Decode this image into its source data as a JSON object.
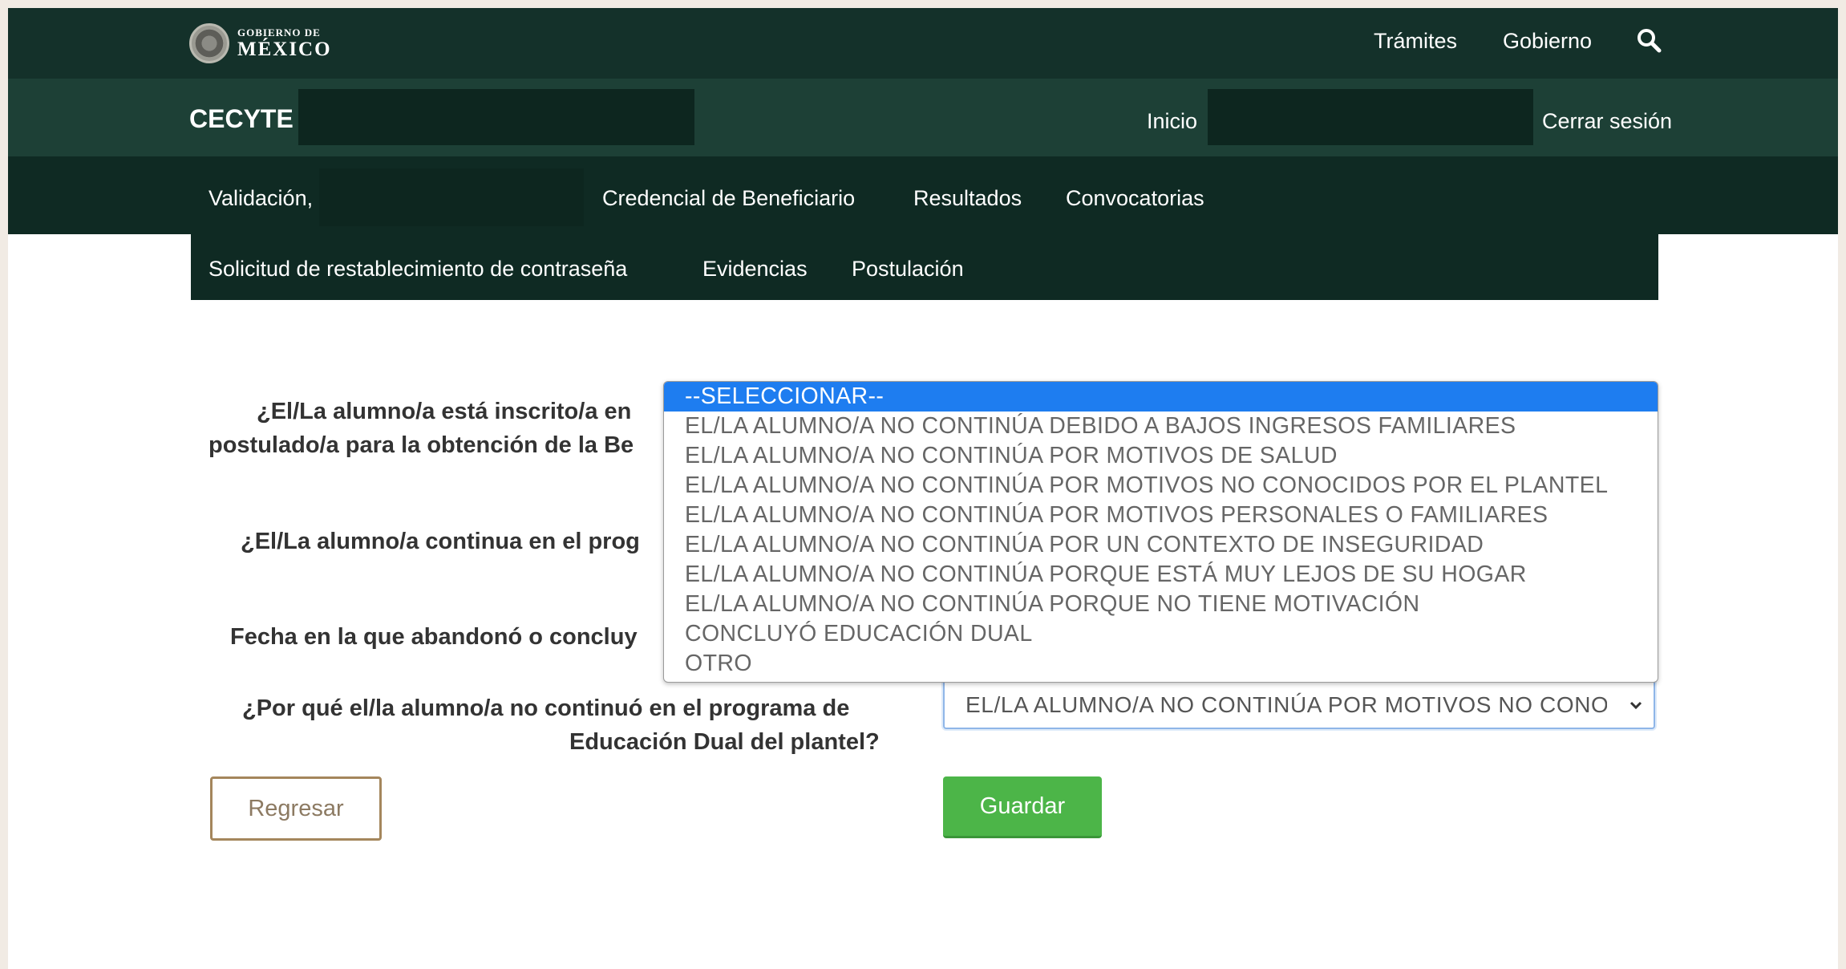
{
  "gov": {
    "logo_small": "GOBIERNO DE",
    "logo_big": "MÉXICO",
    "links": [
      "Trámites",
      "Gobierno"
    ],
    "search_icon": "search-icon"
  },
  "site": {
    "brand": "CECYTE",
    "home": "Inicio",
    "logout": "Cerrar sesión"
  },
  "nav": {
    "validacion": "Validación,",
    "credencial": "Credencial de Beneficiario",
    "resultados": "Resultados",
    "convocatorias": "Convocatorias",
    "solicitud": "Solicitud de restablecimiento de contraseña",
    "evidencias": "Evidencias",
    "postulacion": "Postulación"
  },
  "form": {
    "q1_line1": "¿El/La alumno/a está inscrito/a en",
    "q1_line2": "postulado/a para la obtención de la Be",
    "q2": "¿El/La alumno/a continua en el prog",
    "q3": "Fecha en la que abandonó o concluy",
    "q4_line1": "¿Por qué el/la alumno/a no continuó en el programa de",
    "q4_line2": "Educación Dual del plantel?",
    "select_value": "EL/LA ALUMNO/A NO CONTINÚA POR MOTIVOS NO CONOCIDOS POR EL PLANTEL",
    "options": [
      "--SELECCIONAR--",
      "EL/LA ALUMNO/A NO CONTINÚA DEBIDO A BAJOS INGRESOS FAMILIARES",
      "EL/LA ALUMNO/A NO CONTINÚA POR MOTIVOS DE SALUD",
      "EL/LA ALUMNO/A NO CONTINÚA POR MOTIVOS NO CONOCIDOS POR EL PLANTEL",
      "EL/LA ALUMNO/A NO CONTINÚA POR MOTIVOS PERSONALES O FAMILIARES",
      "EL/LA ALUMNO/A NO CONTINÚA POR UN CONTEXTO DE INSEGURIDAD",
      "EL/LA ALUMNO/A NO CONTINÚA PORQUE ESTÁ MUY LEJOS DE SU HOGAR",
      "EL/LA ALUMNO/A NO CONTINÚA PORQUE NO TIENE MOTIVACIÓN",
      "CONCLUYÓ EDUCACIÓN DUAL",
      "OTRO"
    ],
    "back_label": "Regresar",
    "save_label": "Guardar"
  },
  "colors": {
    "dark_green": "#0f2a23",
    "highlight": "#1e7df0",
    "save_green": "#4cb548"
  }
}
